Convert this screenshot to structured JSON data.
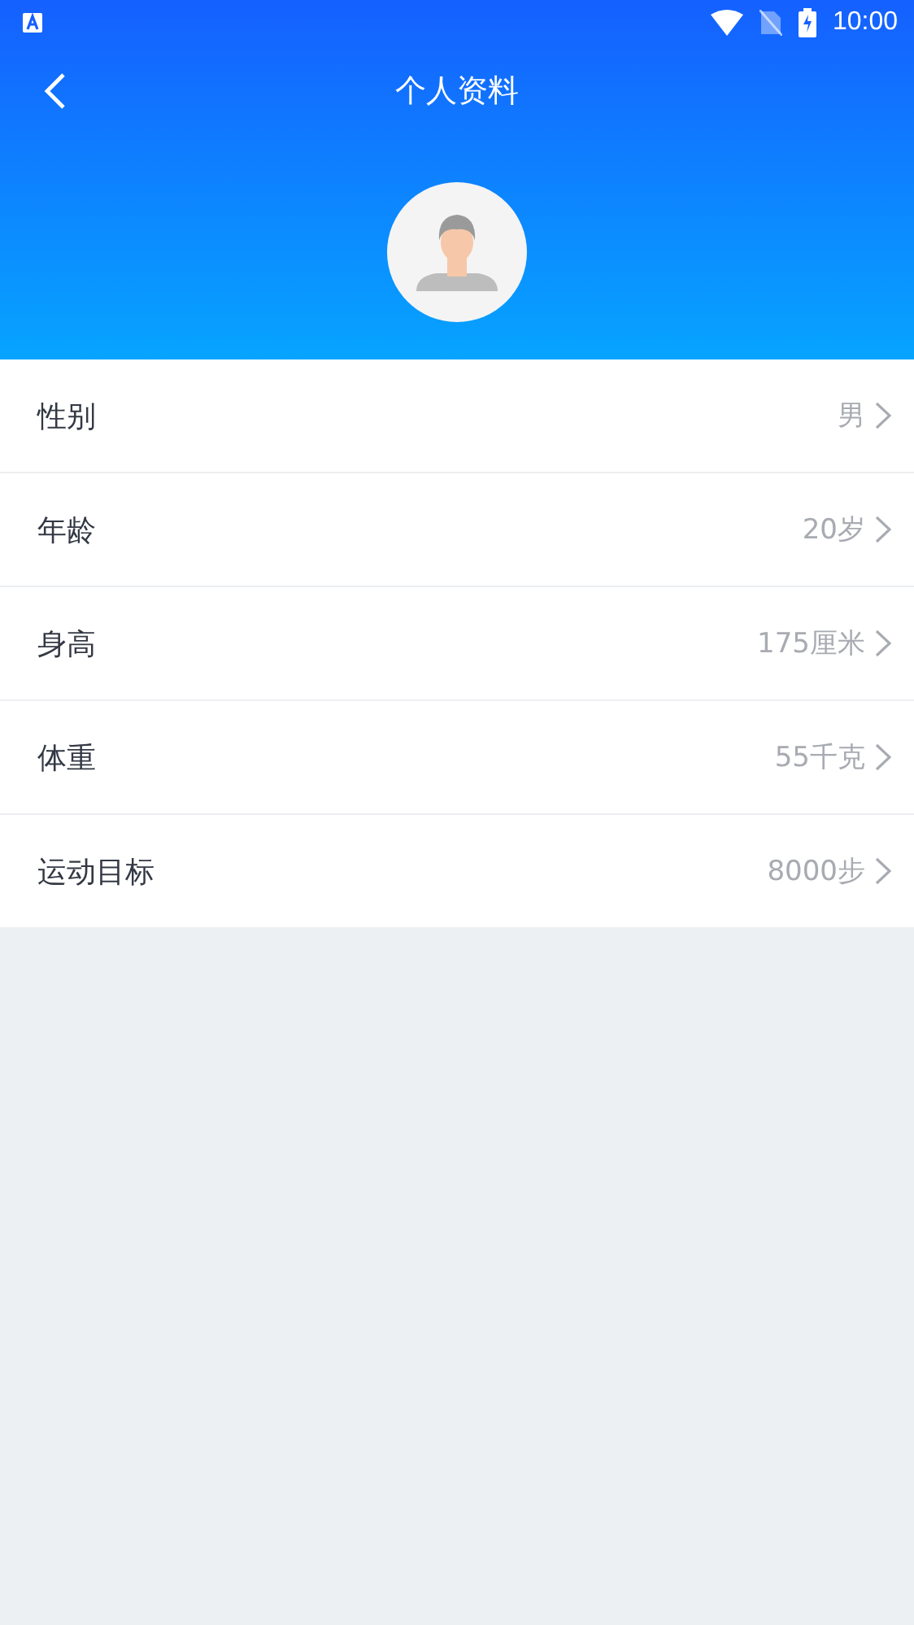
{
  "status_bar": {
    "time": "10:00"
  },
  "header": {
    "title": "个人资料"
  },
  "fields": [
    {
      "label": "性别",
      "value": "男"
    },
    {
      "label": "年龄",
      "value": "20岁"
    },
    {
      "label": "身高",
      "value": "175厘米"
    },
    {
      "label": "体重",
      "value": "55千克"
    },
    {
      "label": "运动目标",
      "value": "8000步"
    }
  ]
}
